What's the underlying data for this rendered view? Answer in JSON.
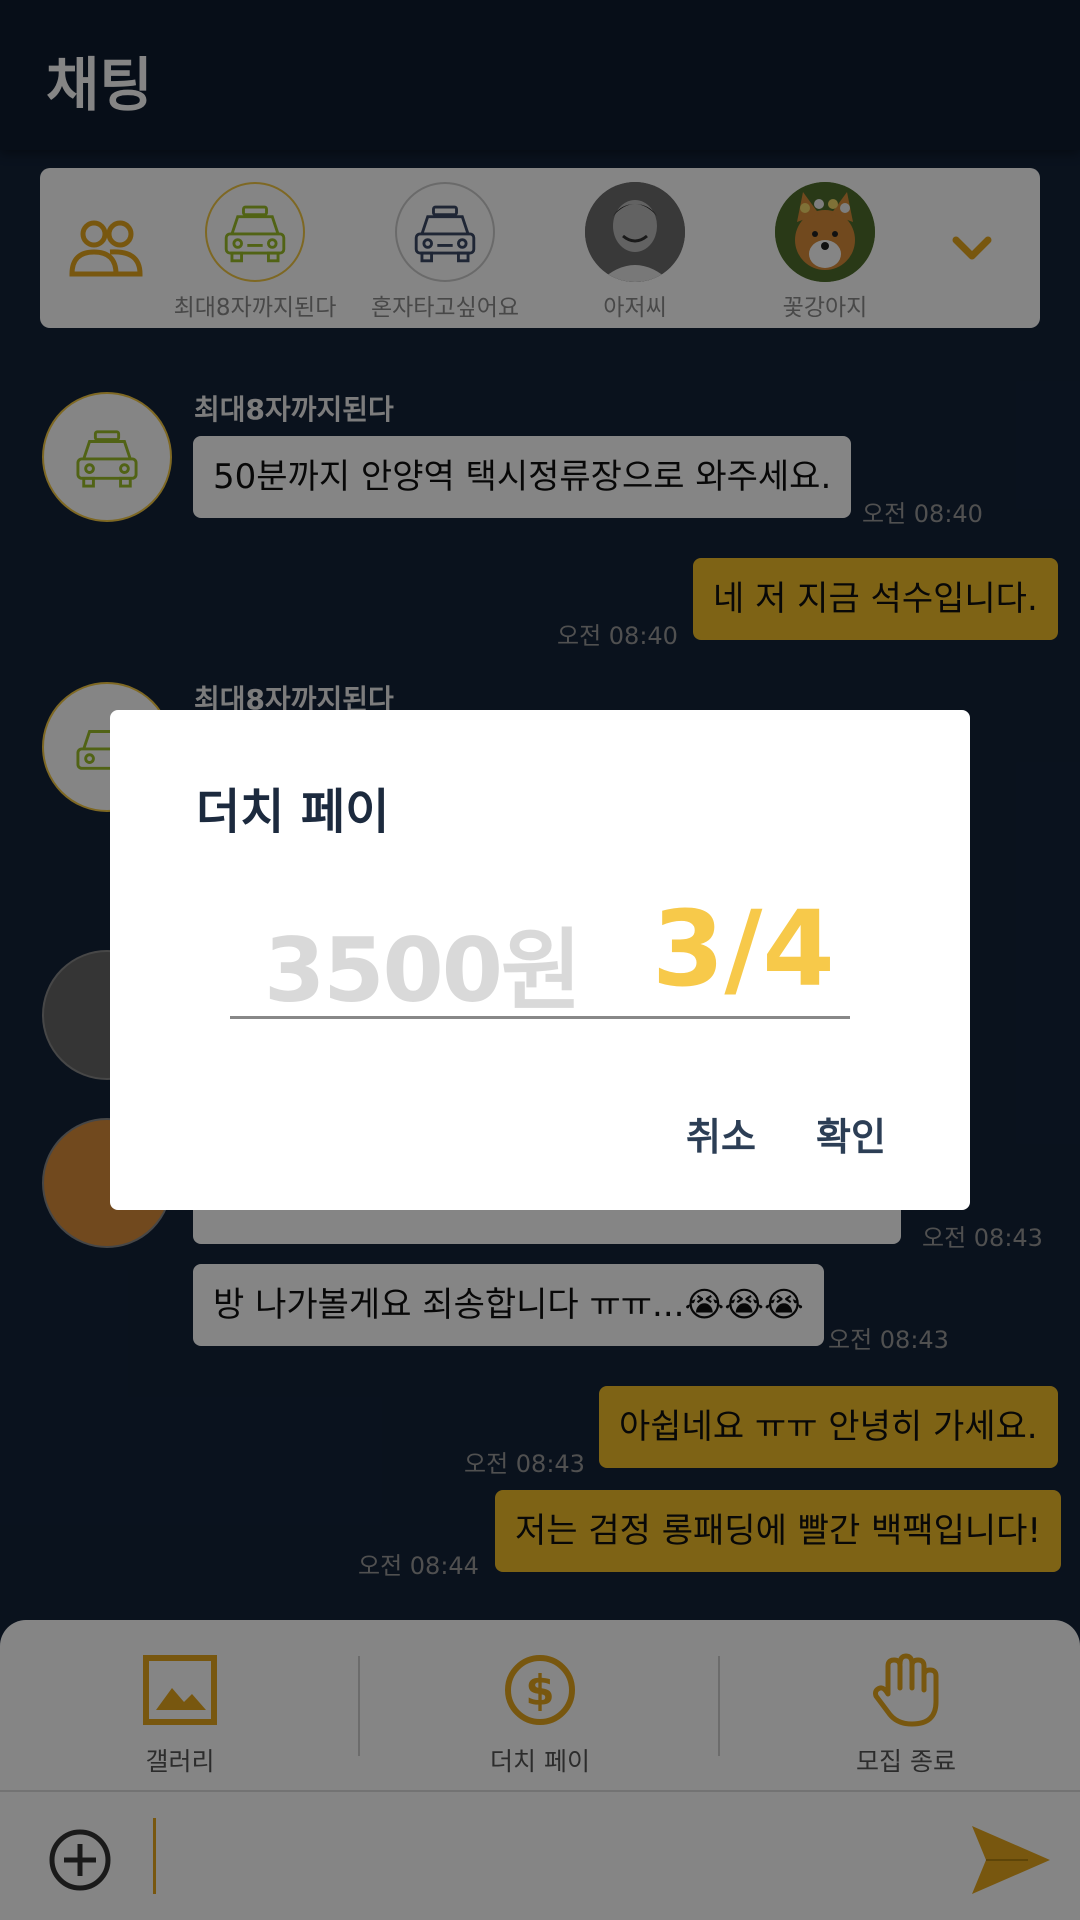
{
  "header": {
    "title": "채팅"
  },
  "members": [
    {
      "name": "최대8자까지된다",
      "avatar": "taxi-icon-green"
    },
    {
      "name": "혼자타고싶어요",
      "avatar": "taxi-icon-navy"
    },
    {
      "name": "아저씨",
      "avatar": "man-photo"
    },
    {
      "name": "꽃강아지",
      "avatar": "dog-photo"
    }
  ],
  "messages": [
    {
      "sender": "최대8자까지된다",
      "text": "50분까지 안양역 택시정류장으로 와주세요.",
      "time": "오전 08:40",
      "direction": "in"
    },
    {
      "text": "네 저 지금 석수입니다.",
      "time": "오전 08:40",
      "direction": "out"
    },
    {
      "sender": "최대8자까지된다",
      "direction": "in"
    },
    {
      "time": "오전 08:43",
      "direction": "in"
    },
    {
      "text": "방 나가볼게요 죄송합니다 ㅠㅠ...😭😭😭",
      "time": "오전 08:43",
      "direction": "in"
    },
    {
      "text": "아쉽네요 ㅠㅠ 안녕히 가세요.",
      "time": "오전 08:43",
      "direction": "out"
    },
    {
      "text": "저는 검정 롱패딩에 빨간 백팩입니다!",
      "time": "오전 08:44",
      "direction": "out"
    }
  ],
  "actions": {
    "gallery": "갤러리",
    "dutch_pay": "더치 페이",
    "close_recruit": "모집 종료"
  },
  "dialog": {
    "title": "더치 페이",
    "amount_placeholder": "3500원",
    "fraction": "3/4",
    "cancel": "취소",
    "confirm": "확인"
  },
  "colors": {
    "accent": "#f2bf2a",
    "background": "#142339",
    "header": "#0f1b2e",
    "fraction": "#f7c94a"
  }
}
